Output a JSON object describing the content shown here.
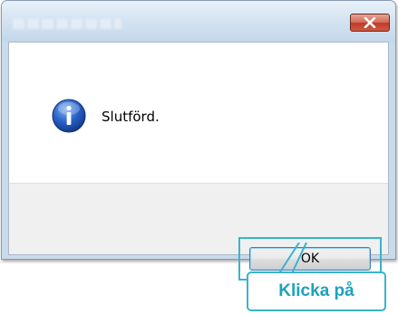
{
  "dialog": {
    "message": "Slutförd.",
    "ok_label": "OK",
    "icon": "info-icon",
    "close_icon": "close-icon"
  },
  "annotation": {
    "callout_text": "Klicka på",
    "accent_color": "#37b4cc"
  }
}
